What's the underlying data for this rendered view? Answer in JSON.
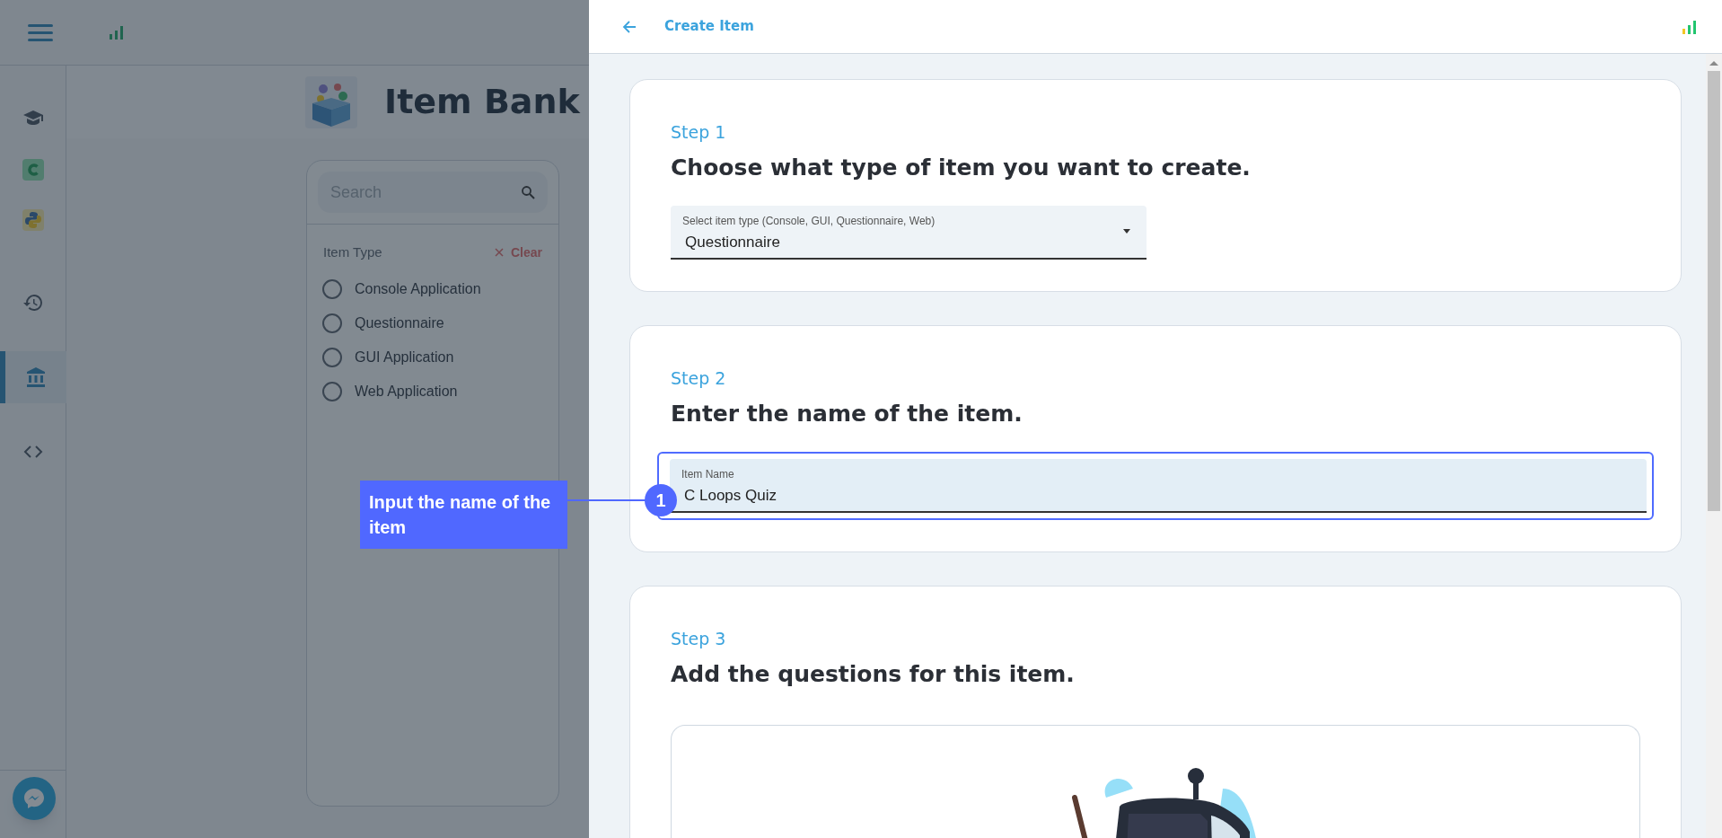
{
  "sidebar": {
    "items": [
      {
        "kind": "cap",
        "selected": false
      },
      {
        "kind": "c",
        "selected": false
      },
      {
        "kind": "python",
        "selected": false
      },
      {
        "kind": "history",
        "selected": false
      },
      {
        "kind": "bank",
        "selected": true
      },
      {
        "kind": "code",
        "selected": false
      }
    ]
  },
  "item_bank": {
    "title": "Item Bank",
    "search": {
      "placeholder": "Search"
    },
    "filter": {
      "label": "Item Type",
      "clear": "Clear",
      "options": [
        {
          "label": "Console Application",
          "selected": false
        },
        {
          "label": "Questionnaire",
          "selected": false
        },
        {
          "label": "GUI Application",
          "selected": false
        },
        {
          "label": "Web Application",
          "selected": false
        }
      ]
    }
  },
  "drawer": {
    "title": "Create Item",
    "steps": [
      {
        "step": "Step 1",
        "heading": "Choose what type of item you want to create.",
        "field": {
          "kind": "select",
          "label": "Select item type (Console, GUI, Questionnaire, Web)",
          "value": "Questionnaire",
          "highlighted": false
        }
      },
      {
        "step": "Step 2",
        "heading": "Enter the name of the item.",
        "field": {
          "kind": "text",
          "label": "Item Name",
          "value": "C Loops Quiz",
          "highlighted": true
        }
      },
      {
        "step": "Step 3",
        "heading": "Add the questions for this item."
      }
    ]
  },
  "callout": {
    "number": "1",
    "text": "Input the name of the item"
  }
}
